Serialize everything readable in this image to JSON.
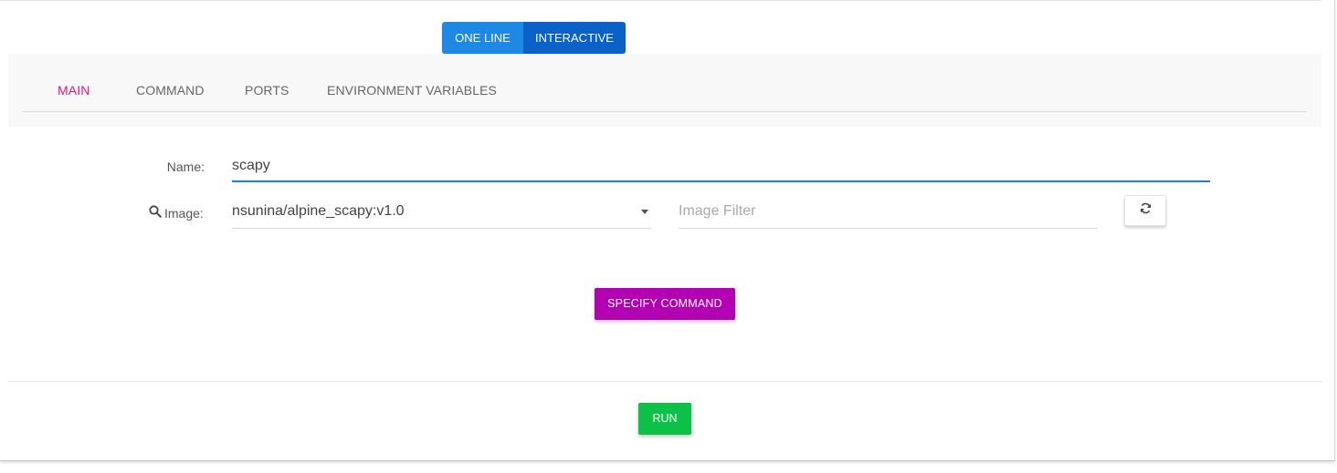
{
  "mode_toggle": {
    "one_line_label": "ONE LINE",
    "interactive_label": "INTERACTIVE"
  },
  "tabs": [
    {
      "label": "MAIN",
      "active": true
    },
    {
      "label": "COMMAND",
      "active": false
    },
    {
      "label": "PORTS",
      "active": false
    },
    {
      "label": "ENVIRONMENT VARIABLES",
      "active": false
    }
  ],
  "form": {
    "name_label": "Name:",
    "name_value": "scapy",
    "image_label": "Image:",
    "image_value": "nsunina/alpine_scapy:v1.0",
    "image_filter_placeholder": "Image Filter",
    "image_icon": "search-icon",
    "refresh_icon": "refresh-icon"
  },
  "actions": {
    "specify_command_label": "SPECIFY COMMAND",
    "run_label": "RUN"
  },
  "colors": {
    "accent_tab": "#e6157c",
    "toggle_one_line": "#1e88e5",
    "toggle_interactive": "#0a62c9",
    "specify_button": "#b300b3",
    "run_button": "#0cc048",
    "input_focus": "#1f7fd8"
  }
}
